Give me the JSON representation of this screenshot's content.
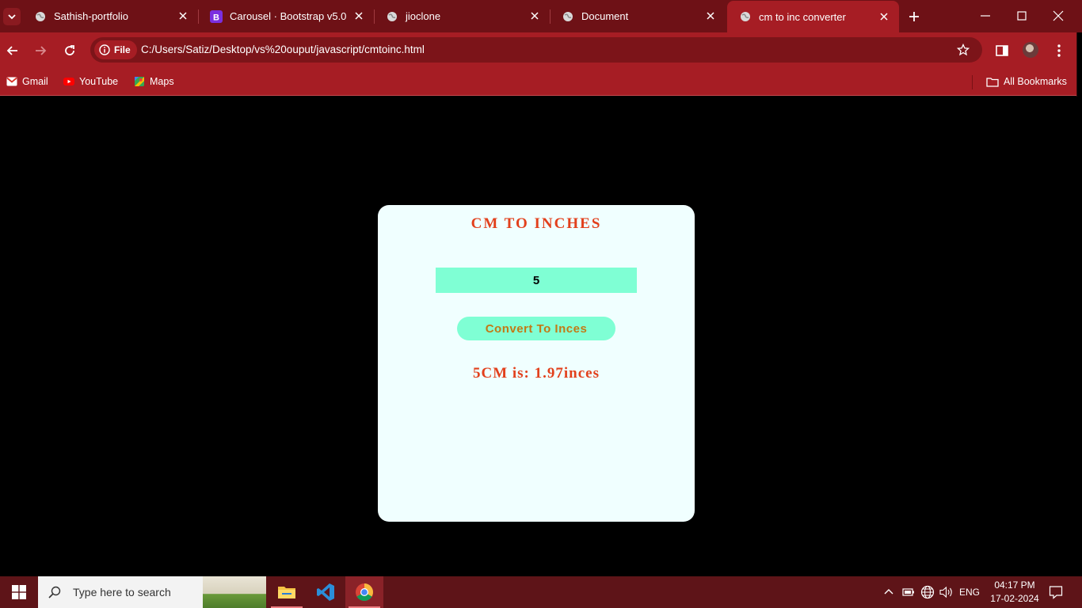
{
  "browser": {
    "tabs": [
      {
        "label": "Sathish-portfolio",
        "icon": "globe-icon"
      },
      {
        "label": "Carousel · Bootstrap v5.0",
        "icon": "bootstrap-icon"
      },
      {
        "label": "jioclone",
        "icon": "globe-icon"
      },
      {
        "label": "Document",
        "icon": "globe-icon"
      },
      {
        "label": "cm to inc converter",
        "icon": "globe-icon"
      }
    ],
    "active_tab": 4,
    "url_chip": "File",
    "url": "C:/Users/Satiz/Desktop/vs%20ouput/javascript/cmtoinc.html",
    "bookmarks": [
      {
        "label": "Gmail",
        "icon": "gmail-icon"
      },
      {
        "label": "YouTube",
        "icon": "youtube-icon"
      },
      {
        "label": "Maps",
        "icon": "maps-icon"
      }
    ],
    "all_bookmarks": "All Bookmarks"
  },
  "page": {
    "title": "CM TO INCHES",
    "input_value": "5",
    "button_label": "Convert To Inces",
    "result": "5CM is: 1.97inces",
    "colors": {
      "card_bg": "#f0ffff",
      "accent": "#e2401c",
      "aquamarine": "#7fffd4",
      "button_text": "#c27a15"
    }
  },
  "taskbar": {
    "search_placeholder": "Type here to search",
    "language": "ENG",
    "time": "04:17 PM",
    "date": "17-02-2024"
  }
}
